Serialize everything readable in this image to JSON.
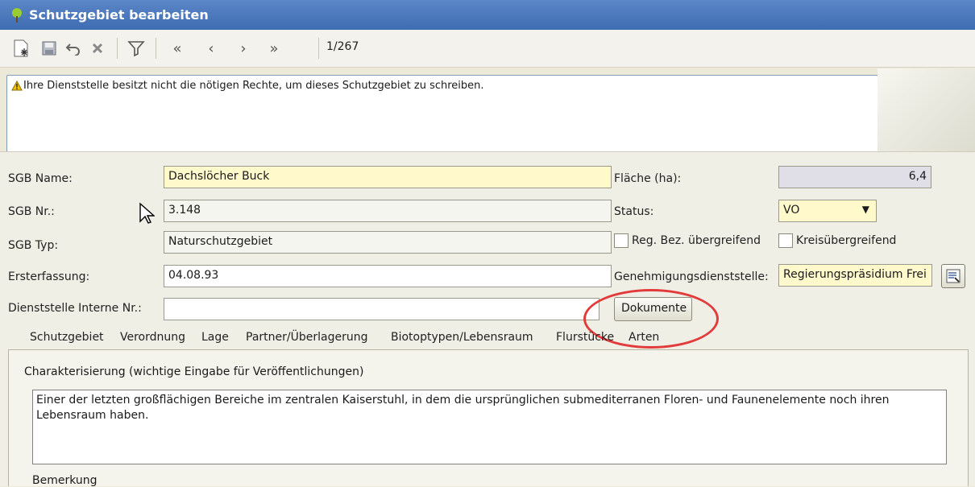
{
  "window": {
    "title": "Schutzgebiet bearbeiten"
  },
  "toolbar": {
    "record_position": "1/267",
    "buttons": [
      "new-record-icon",
      "save-icon",
      "undo-icon",
      "delete-icon",
      "filter-icon",
      "first-record-icon",
      "previous-record-icon",
      "next-record-icon",
      "last-record-icon"
    ]
  },
  "message": {
    "text": "Ihre Dienststelle besitzt nicht die nötigen Rechte, um dieses Schutzgebiet zu schreiben."
  },
  "form": {
    "sgb_name_label": "SGB Name:",
    "sgb_name_value": "Dachslöcher Buck",
    "sgb_nr_label": "SGB Nr.:",
    "sgb_nr_value": "3.148",
    "sgb_typ_label": "SGB Typ:",
    "sgb_typ_value": "Naturschutzgebiet",
    "ersterfassung_label": "Ersterfassung:",
    "ersterfassung_value": "04.08.93",
    "interne_nr_label": "Dienststelle Interne Nr.:",
    "interne_nr_value": "",
    "flaeche_label": "Fläche (ha):",
    "flaeche_value": "6,4",
    "status_label": "Status:",
    "status_value": "VO",
    "reg_bez_label": "Reg. Bez. übergreifend",
    "kreis_label": "Kreisübergreifend",
    "genehmigung_label": "Genehmigungsdienststelle:",
    "genehmigung_value": "Regierungspräsidium Frei",
    "dokumente_button": "Dokumente"
  },
  "tabs": [
    "Schutzgebiet",
    "Verordnung",
    "Lage",
    "Partner/Überlagerung",
    "Biotoptypen/Lebensraum",
    "Flurstücke",
    "Arten"
  ],
  "tab_content": {
    "charakterisierung_label": "Charakterisierung (wichtige Eingabe für Veröffentlichungen)",
    "charakterisierung_text": "Einer der letzten großflächigen Bereiche im zentralen Kaiserstuhl, in dem die ursprünglichen submediterranen Floren- und Faunenelemente noch ihren Lebensraum haben.",
    "bemerkung_label": "Bemerkung"
  }
}
